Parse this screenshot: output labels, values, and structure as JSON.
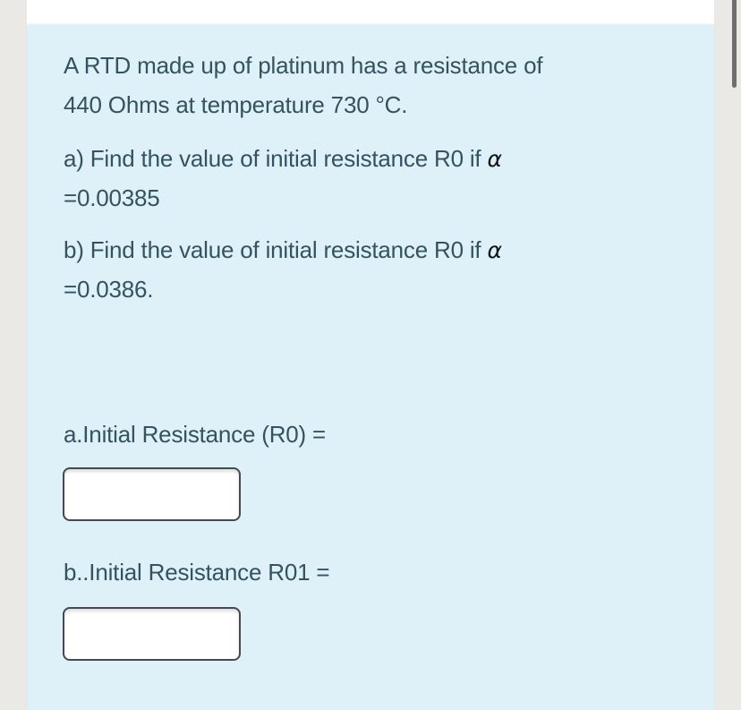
{
  "question": {
    "intro_line1": "A RTD made up of platinum  has a  resistance of",
    "intro_line2": "440 Ohms at temperature 730 °C.",
    "part_a_line1": "a)  Find the value of initial resistance R0 if ",
    "part_a_alpha": "α",
    "part_a_line2": "=0.00385",
    "part_b_line1": "b) Find the value of initial resistance R0  if ",
    "part_b_alpha": "α",
    "part_b_line2": "=0.0386."
  },
  "answers": {
    "a_label": "a.Initial Resistance (R0)  =",
    "a_value": "",
    "b_label": "b..Initial Resistance R01 =",
    "b_value": ""
  },
  "colors": {
    "background": "#ebe9e6",
    "panel": "#def1f8",
    "text": "#34525f",
    "input_border": "#434b50",
    "scrollbar": "#6e6e6e"
  }
}
